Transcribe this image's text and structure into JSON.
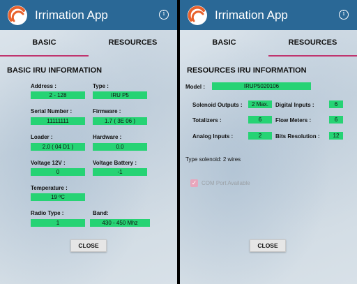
{
  "app": {
    "title": "Irrimation App"
  },
  "tabs": {
    "basic": "BASIC",
    "resources": "RESOURCES"
  },
  "colors": {
    "appbar": "#2a6896",
    "value_bg": "#26d374",
    "tab_indicator": "#c0346e",
    "logo": "#e8612c"
  },
  "basic": {
    "section_title": "BASIC IRU INFORMATION",
    "fields": {
      "address": {
        "label": "Address :",
        "value": "2 - 128"
      },
      "type": {
        "label": "Type :",
        "value": "IRU P5"
      },
      "serial": {
        "label": "Serial Number :",
        "value": "11111111"
      },
      "firmware": {
        "label": "Firmware :",
        "value": "1.7 ( 3E 06 )"
      },
      "loader": {
        "label": "Loader :",
        "value": "2.0 ( 04 D1 )"
      },
      "hardware": {
        "label": "Hardware :",
        "value": "0.0"
      },
      "voltage": {
        "label": "Voltage 12V :",
        "value": "0"
      },
      "battery": {
        "label": "Voltage Battery :",
        "value": "-1"
      },
      "temperature": {
        "label": "Temperature :",
        "value": "19 ºC"
      },
      "radio": {
        "label": "Radio Type :",
        "value": "1"
      },
      "band": {
        "label": "Band:",
        "value": "430 - 450 Mhz"
      }
    },
    "close_label": "CLOSE"
  },
  "resources": {
    "section_title": "RESOURCES IRU INFORMATION",
    "model": {
      "label": "Model :",
      "value": "IRUP5020106"
    },
    "fields": {
      "solenoid_outputs": {
        "label": "Solenoid Outputs :",
        "value": "2 Max."
      },
      "digital_inputs": {
        "label": "Digital Inputs :",
        "value": "6"
      },
      "totalizers": {
        "label": "Totalizers :",
        "value": "6"
      },
      "flow_meters": {
        "label": "Flow Meters :",
        "value": "6"
      },
      "analog_inputs": {
        "label": "Analog Inputs :",
        "value": "2"
      },
      "bits_resolution": {
        "label": "Bits Resolution :",
        "value": "12"
      }
    },
    "type_solenoid": "Type solenoid: 2 wires",
    "com_port_label": "COM Port Available",
    "com_port_checked": true,
    "close_label": "CLOSE"
  }
}
